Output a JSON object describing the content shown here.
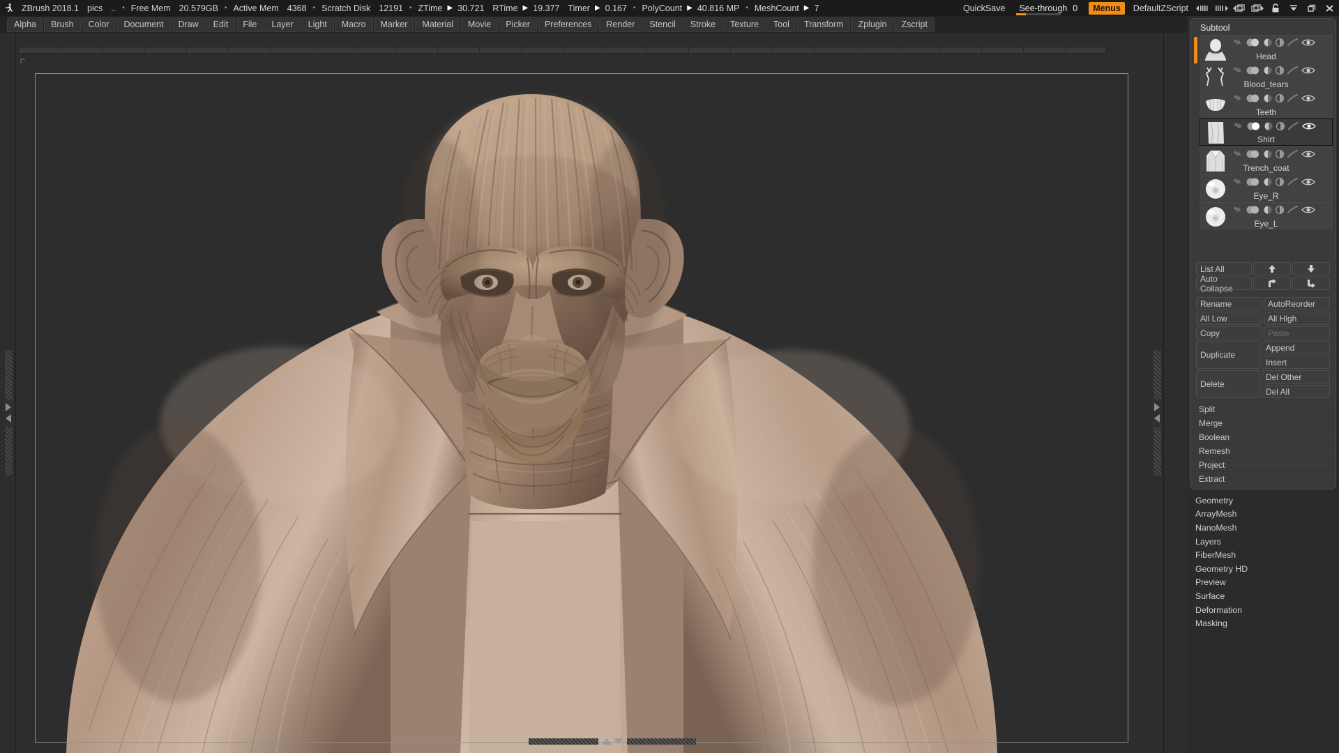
{
  "titlebar": {
    "logo_icon": "zbrush-runner-logo",
    "app_name": "ZBrush 2018.1",
    "project": "pics",
    "ellipsis": "..",
    "stats": [
      {
        "label": "Free Mem",
        "value": "20.579GB",
        "sep": "•"
      },
      {
        "label": "Active Mem",
        "value": "4368",
        "sep": "•"
      },
      {
        "label": "Scratch Disk",
        "value": "12191",
        "sep": "•"
      }
    ],
    "timers": [
      {
        "label": "ZTime",
        "value": "30.721"
      },
      {
        "label": "RTime",
        "value": "19.377"
      },
      {
        "label": "Timer",
        "value": "0.167"
      }
    ],
    "counts": [
      {
        "label": "PolyCount",
        "value": "40.816 MP"
      },
      {
        "label": "MeshCount",
        "value": "7"
      }
    ],
    "quicksave_label": "QuickSave",
    "seethrough_label": "See-through",
    "seethrough_value": "0",
    "menus_label": "Menus",
    "zscript_label": "DefaultZScript",
    "icons": [
      "scroll-left-icon",
      "scroll-right-icon",
      "popup-left-icon",
      "popup-right-icon",
      "lock-icon",
      "minimize-icon",
      "restore-icon",
      "close-icon"
    ],
    "accent_orange": "#f08c18"
  },
  "menubar": {
    "items": [
      "Alpha",
      "Brush",
      "Color",
      "Document",
      "Draw",
      "Edit",
      "File",
      "Layer",
      "Light",
      "Macro",
      "Marker",
      "Material",
      "Movie",
      "Picker",
      "Preferences",
      "Render",
      "Stencil",
      "Stroke",
      "Texture",
      "Tool",
      "Transform",
      "Zplugin",
      "Zscript"
    ]
  },
  "canvas": {
    "background_color": "#2d2d2d",
    "document_border_color": "#8e8e8e",
    "model_name": "bald-wrinkled-character-bust",
    "model_material_color": "#a88d78",
    "bottom_scroll_up_icon": "scroll-up-icon",
    "bottom_scroll_down_icon": "scroll-down-icon"
  },
  "subtool_panel": {
    "title": "Subtool",
    "selected_index": 3,
    "active_index": 0,
    "items": [
      {
        "name": "Head",
        "thumb": "head-bust-thumb"
      },
      {
        "name": "Blood_tears",
        "thumb": "blood-tears-thumb"
      },
      {
        "name": "Teeth",
        "thumb": "teeth-thumb"
      },
      {
        "name": "Shirt",
        "thumb": "shirt-thumb"
      },
      {
        "name": "Trench_coat",
        "thumb": "trench-coat-thumb"
      },
      {
        "name": "Eye_R",
        "thumb": "eye-sphere-thumb"
      },
      {
        "name": "Eye_L",
        "thumb": "eye-sphere-thumb"
      }
    ],
    "row_icons": [
      "subdivision-arrow-icon",
      "polypaint-icon",
      "shading-icon",
      "transparency-icon",
      "brush-stroke-icon",
      "eye-visibility-icon"
    ]
  },
  "subtool_buttons": {
    "list_all": "List All",
    "auto_collapse": "Auto Collapse",
    "move_up_icon": "arrow-up-icon",
    "move_down_icon": "arrow-down-icon",
    "move_out_icon": "arrow-turn-up-icon",
    "move_in_icon": "arrow-turn-down-icon",
    "rename": "Rename",
    "auto_reorder": "AutoReorder",
    "all_low": "All Low",
    "all_high": "All High",
    "copy": "Copy",
    "paste": "Paste",
    "duplicate": "Duplicate",
    "append": "Append",
    "insert": "Insert",
    "delete": "Delete",
    "del_other": "Del Other",
    "del_all": "Del All"
  },
  "subtool_ops": [
    "Split",
    "Merge",
    "Boolean",
    "Remesh",
    "Project",
    "Extract"
  ],
  "tool_sections": [
    "Geometry",
    "ArrayMesh",
    "NanoMesh",
    "Layers",
    "FiberMesh",
    "Geometry HD",
    "Preview",
    "Surface",
    "Deformation",
    "Masking"
  ]
}
